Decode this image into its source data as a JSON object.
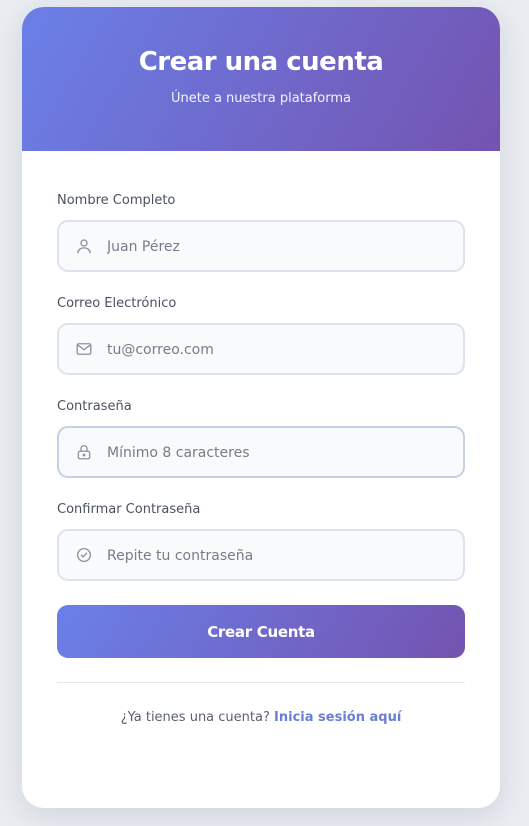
{
  "header": {
    "title": "Crear una cuenta",
    "subtitle": "Únete a nuestra plataforma"
  },
  "fields": [
    {
      "label": "Nombre Completo",
      "placeholder": "Juan Pérez",
      "icon": "user-icon"
    },
    {
      "label": "Correo Electrónico",
      "placeholder": "tu@correo.com",
      "icon": "mail-icon"
    },
    {
      "label": "Contraseña",
      "placeholder": "Mínimo 8 caracteres",
      "icon": "lock-icon"
    },
    {
      "label": "Confirmar Contraseña",
      "placeholder": "Repite tu contraseña",
      "icon": "check-circle-icon"
    }
  ],
  "submit_label": "Crear Cuenta",
  "footer": {
    "prompt": "¿Ya tienes una cuenta?",
    "link": "Inicia sesión aquí"
  },
  "colors": {
    "gradient_start": "#6a80e8",
    "gradient_end": "#7453b0",
    "link": "#6a7fd8",
    "background": "#e9ecf1"
  }
}
